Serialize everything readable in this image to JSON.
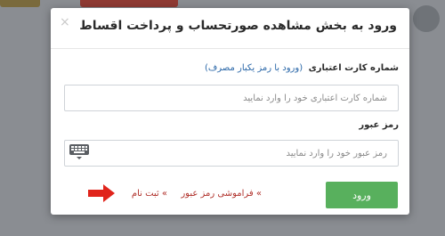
{
  "modal": {
    "title": "ورود به بخش مشاهده صورتحساب و پرداخت اقساط",
    "close_label": "×",
    "card": {
      "label": "شماره کارت اعتباری",
      "otp_link": "(ورود با رمز یکبار مصرف)",
      "placeholder": "شماره کارت اعتباری خود را وارد نمایید",
      "value": ""
    },
    "password": {
      "label": "رمز عبور",
      "placeholder": "رمز عبور خود را وارد نمایید",
      "value": ""
    },
    "login_button": "ورود",
    "forgot_link": "» فراموشی رمز عبور",
    "register_link": "» ثبت نام"
  },
  "icons": {
    "close": "close-icon",
    "keyboard": "keyboard-icon",
    "arrow": "red-arrow-icon"
  },
  "colors": {
    "login_button": "#58b05d",
    "links": "#b0302a",
    "otp_link": "#2a67a8",
    "arrow": "#e0241b"
  }
}
